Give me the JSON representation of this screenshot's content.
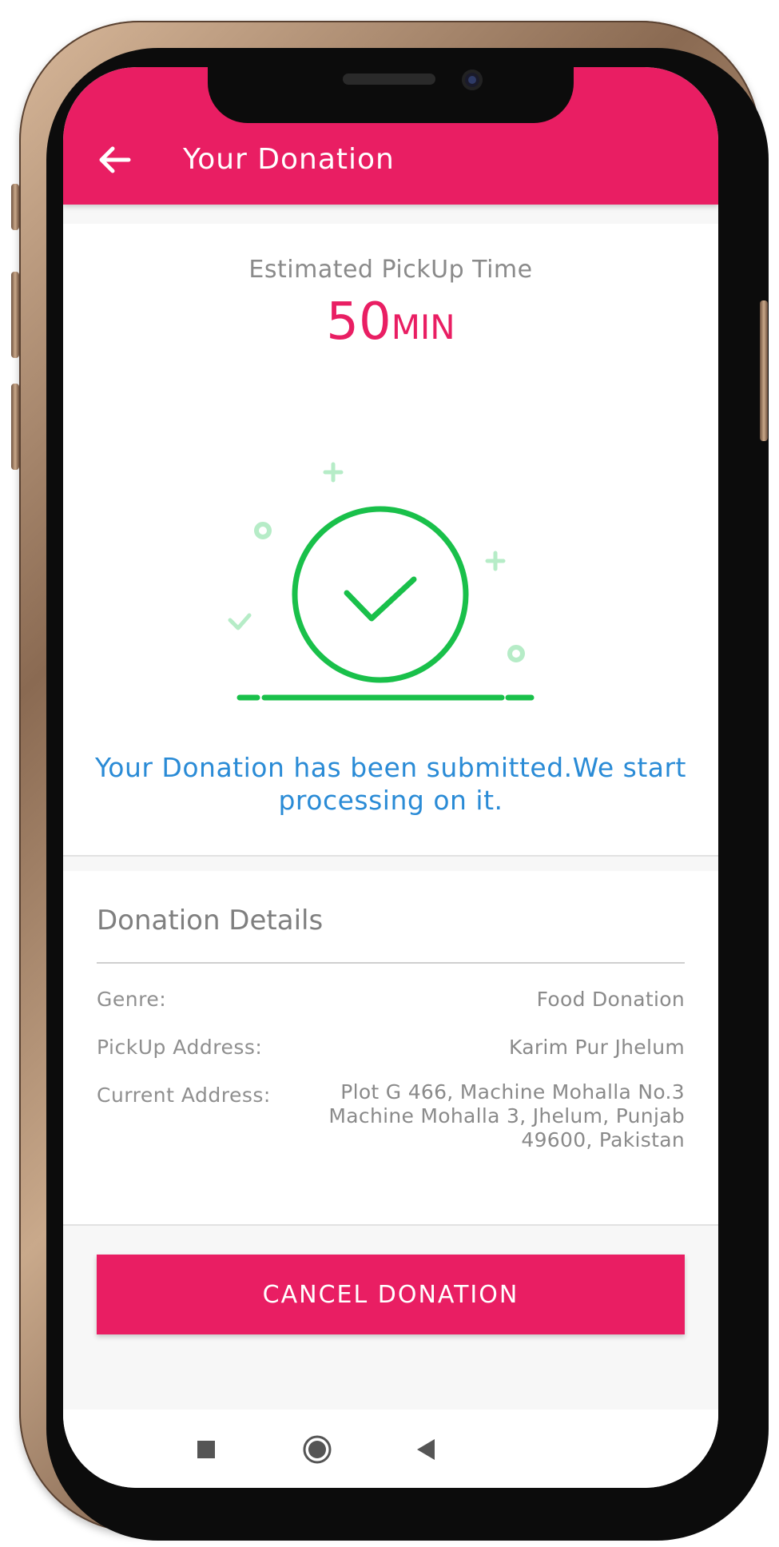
{
  "appbar": {
    "title": "Your Donation",
    "back_icon": "arrow-left-icon",
    "color": "#e91e63"
  },
  "status": {
    "eta_label": "Estimated PickUp Time",
    "eta_value": "50",
    "eta_unit": "MIN",
    "illustration_icon": "check-circle-icon",
    "message": "Your Donation has been submitted.We start processing on it.",
    "success_color": "#19c04a",
    "message_color": "#2a8bd6"
  },
  "details": {
    "title": "Donation Details",
    "rows": [
      {
        "label": "Genre:",
        "value": "Food Donation"
      },
      {
        "label": "PickUp Address:",
        "value": "Karim Pur Jhelum"
      },
      {
        "label": "Current Address:",
        "value_lines": [
          "Plot G 466, Machine Mohalla No.3",
          "Machine Mohalla 3, Jhelum, Punjab",
          "49600, Pakistan"
        ]
      }
    ]
  },
  "actions": {
    "cancel_label": "Cancel Donation"
  },
  "navbar": {
    "icons": [
      "square-icon",
      "circle-icon",
      "triangle-back-icon"
    ]
  }
}
